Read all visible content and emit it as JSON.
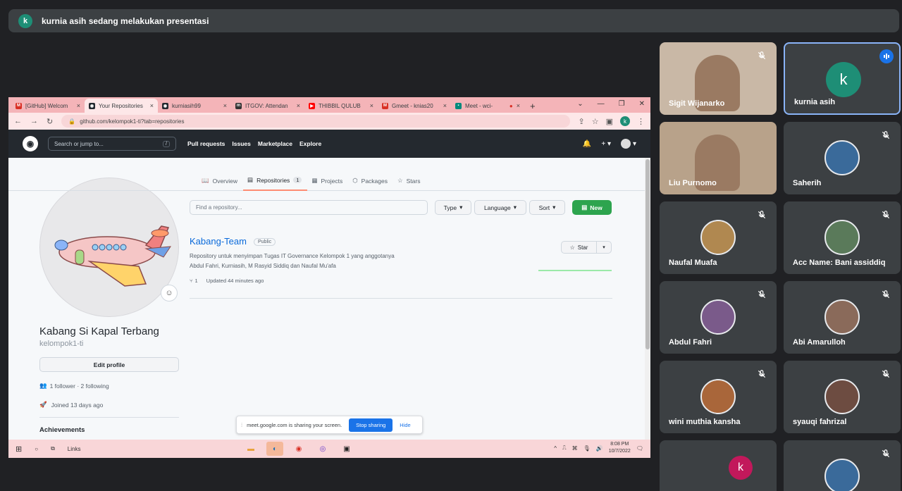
{
  "banner": {
    "avatar_letter": "k",
    "text": "kurnia asih sedang melakukan presentasi"
  },
  "browser": {
    "tabs": [
      {
        "title": "[GitHub] Welcom",
        "icon": "gmail-icon",
        "color": "#d93025"
      },
      {
        "title": "Your Repositories",
        "icon": "github-icon",
        "color": "#24292f"
      },
      {
        "title": "kurniasih99",
        "icon": "github-icon",
        "color": "#24292f"
      },
      {
        "title": "ITGOV: Attendan",
        "icon": "moodle-icon",
        "color": "#333333"
      },
      {
        "title": "THIBBIL QULUB",
        "icon": "youtube-icon",
        "color": "#ff0000"
      },
      {
        "title": "Gmeet - knias20",
        "icon": "gmail-icon",
        "color": "#d93025"
      },
      {
        "title": "Meet - wci-",
        "icon": "meet-icon",
        "color": "#00897b"
      }
    ],
    "new_tab": "+",
    "url": "github.com/kelompok1-ti?tab=repositories",
    "profile_letter": "k"
  },
  "github": {
    "search_placeholder": "Search or jump to...",
    "search_key": "/",
    "nav": [
      "Pull requests",
      "Issues",
      "Marketplace",
      "Explore"
    ],
    "profile_tabs": [
      {
        "label": "Overview",
        "count": ""
      },
      {
        "label": "Repositories",
        "count": "1"
      },
      {
        "label": "Projects",
        "count": ""
      },
      {
        "label": "Packages",
        "count": ""
      },
      {
        "label": "Stars",
        "count": ""
      }
    ],
    "name": "Kabang Si Kapal Terbang",
    "username": "kelompok1-ti",
    "edit_profile": "Edit profile",
    "followers": "1 follower · 2 following",
    "joined": "Joined 13 days ago",
    "achievements": "Achievements",
    "find_placeholder": "Find a repository...",
    "filters": {
      "type": "Type",
      "language": "Language",
      "sort": "Sort",
      "new": "New"
    },
    "repo": {
      "name": "Kabang-Team",
      "visibility": "Public",
      "description": "Repository untuk menyimpan Tugas IT Governance Kelompok 1 yang anggotanya Abdul Fahri, Kurniasih, M Rasyid Siddiq dan Naufal Mu'afa",
      "forks": "1",
      "updated": "Updated 44 minutes ago",
      "star": "Star"
    }
  },
  "share_notice": {
    "text": "meet.google.com is sharing your screen.",
    "stop": "Stop sharing",
    "hide": "Hide"
  },
  "taskbar": {
    "links": "Links",
    "time": "8:08 PM",
    "date": "10/7/2022"
  },
  "participants": [
    {
      "name": "Sigit Wijanarko",
      "video": true,
      "muted": true
    },
    {
      "name": "kurnia asih",
      "video": false,
      "muted": false,
      "letter": "k",
      "speaking": true
    },
    {
      "name": "Liu Purnomo",
      "video": true,
      "muted": false
    },
    {
      "name": "Saherih",
      "video": false,
      "muted": true
    },
    {
      "name": "Naufal Muafa",
      "video": false,
      "muted": true
    },
    {
      "name": "Acc Name: Bani assiddiq",
      "video": false,
      "muted": true
    },
    {
      "name": "Abdul Fahri",
      "video": false,
      "muted": true
    },
    {
      "name": "Abi Amarulloh",
      "video": false,
      "muted": true
    },
    {
      "name": "wini muthia kansha",
      "video": false,
      "muted": true
    },
    {
      "name": "syauqi fahrizal",
      "video": false,
      "muted": true
    },
    {
      "name": "",
      "video": false,
      "muted": false,
      "letter": "k"
    },
    {
      "name": "",
      "video": false,
      "muted": true
    }
  ]
}
